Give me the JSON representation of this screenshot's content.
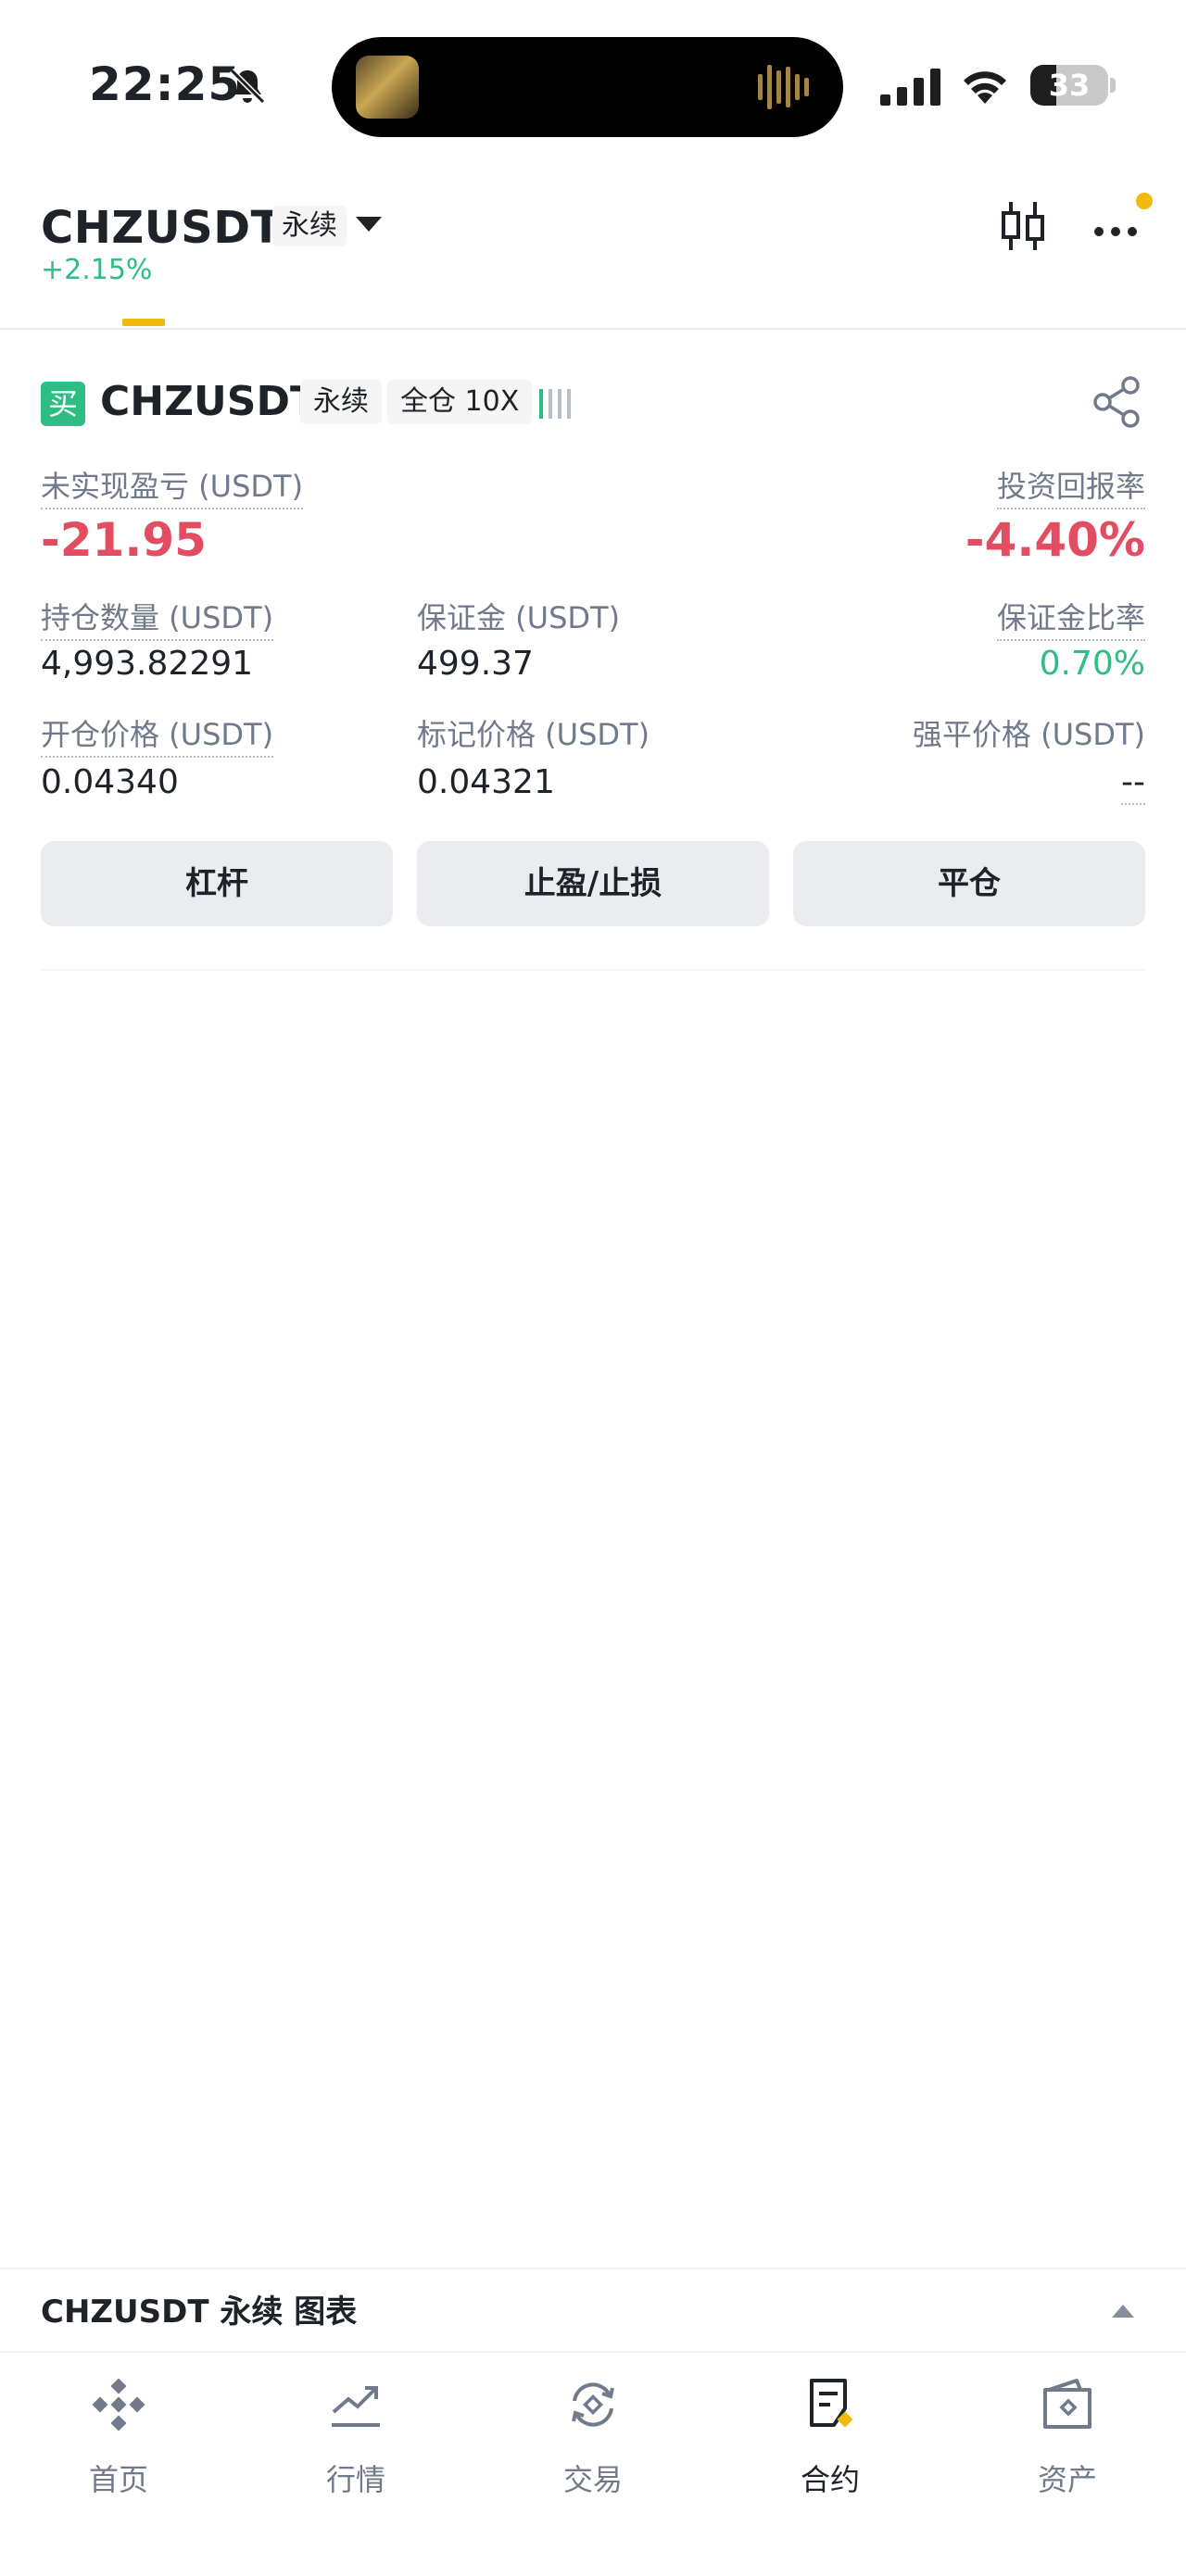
{
  "status_bar": {
    "time": "22:25",
    "battery": "33",
    "battery_level": 0.33
  },
  "header": {
    "symbol": "CHZUSDT",
    "contract_type": "永续",
    "change": "+2.15%"
  },
  "position": {
    "side": "买",
    "symbol": "CHZUSDT",
    "contract_type": "永续",
    "margin_mode": "全仓 10X",
    "unrealized_pnl_label": "未实现盈亏 (USDT)",
    "unrealized_pnl": "-21.95",
    "roi_label": "投资回报率",
    "roi": "-4.40%",
    "size_label": "持仓数量 (USDT)",
    "size": "4,993.82291",
    "margin_label": "保证金 (USDT)",
    "margin": "499.37",
    "margin_ratio_label": "保证金比率",
    "margin_ratio": "0.70%",
    "entry_price_label": "开仓价格 (USDT)",
    "entry_price": "0.04340",
    "mark_price_label": "标记价格 (USDT)",
    "mark_price": "0.04321",
    "liq_price_label": "强平价格 (USDT)",
    "liq_price": "--",
    "buttons": {
      "leverage": "杠杆",
      "tp_sl": "止盈/止损",
      "close": "平仓"
    }
  },
  "chart_strip": {
    "label": "CHZUSDT 永续 图表"
  },
  "bottom_nav": {
    "items": [
      {
        "label": "首页",
        "icon": "home-icon"
      },
      {
        "label": "行情",
        "icon": "markets-icon"
      },
      {
        "label": "交易",
        "icon": "trade-icon"
      },
      {
        "label": "合约",
        "icon": "futures-icon",
        "active": true
      },
      {
        "label": "资产",
        "icon": "wallet-icon"
      }
    ]
  },
  "colors": {
    "accent": "#f0b90b",
    "up": "#2ebd85",
    "down": "#e24d62"
  }
}
